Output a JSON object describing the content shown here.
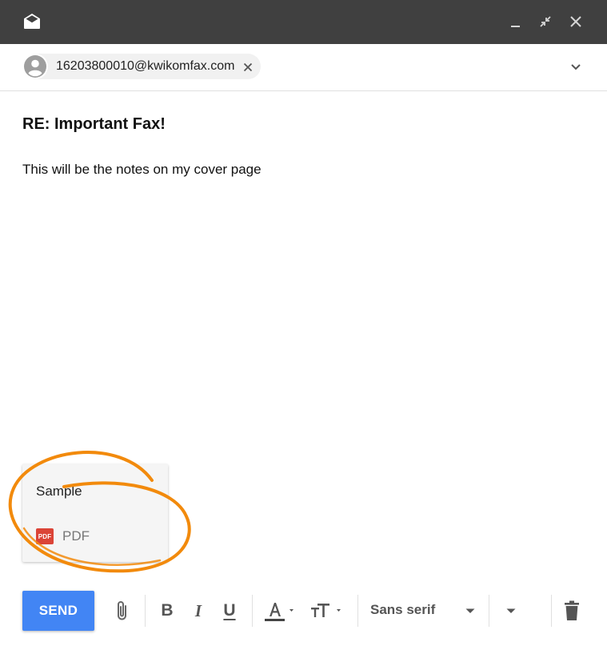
{
  "titlebar": {
    "icons": [
      "envelope-open-icon",
      "minimize-icon",
      "exit-fullscreen-icon",
      "close-icon"
    ]
  },
  "recipient": {
    "email": "16203800010@kwikomfax.com"
  },
  "subject": "RE: Important Fax!",
  "body": "This will be the notes on my cover page",
  "attachment": {
    "name": "Sample",
    "badge": "PDF",
    "type": "PDF"
  },
  "toolbar": {
    "send_label": "SEND",
    "bold_label": "B",
    "italic_label": "I",
    "underline_label": "U",
    "font_family": "Sans serif"
  },
  "colors": {
    "titlebar": "#404040",
    "send": "#4285f4",
    "highlight": "#f28a0c",
    "pdf": "#db4437"
  }
}
